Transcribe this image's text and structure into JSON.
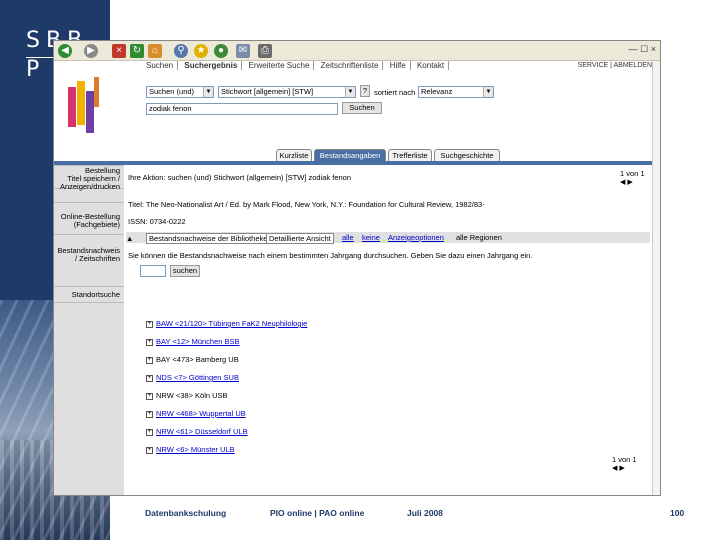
{
  "logo": {
    "line1": "SBB",
    "line2": "P"
  },
  "browser_toolbar": {
    "icons": [
      "back-icon",
      "forward-icon",
      "stop-icon",
      "refresh-icon",
      "home-icon",
      "search-icon",
      "favorites-icon",
      "media-icon",
      "mail-icon",
      "print-icon"
    ],
    "window_controls": "— ☐ ×"
  },
  "topnav": {
    "items": [
      "Suchen",
      "Suchergebnis",
      "Erweiterte Suche",
      "Zeitschriftenliste",
      "Hilfe",
      "Kontakt"
    ],
    "active_index": 1,
    "right_text": "SERVICE | ABMELDEN"
  },
  "search": {
    "field_select": "Suchen (und)",
    "index_select": "Stichwort [allgemein] [STW]",
    "sort_label": "sortiert nach",
    "sort_select": "Relevanz",
    "query_value": "zodiak fenon",
    "submit_label": "Suchen"
  },
  "tabs": [
    "Kurzliste",
    "Bestandsangaben",
    "Trefferliste",
    "Suchgeschichte"
  ],
  "active_tab": 1,
  "sidenav": [
    "Bestellung",
    "Titel speichern / Anzeigen/drucken",
    "Online-Bestellung (Fachgebiete)",
    "Bestandsnachweis / Zeitschriften",
    "Standortsuche"
  ],
  "main": {
    "current_action": "Ihre Aktion: suchen (und) Stichwort (allgemein) [STW] zodiak fenon",
    "hits_label": "1 von 1",
    "title_line": "Titel: The Neo-Nationalist Art / Ed. by Mark Flood, New York, N.Y.: Foundation for Cultural Review, 1982/83-",
    "issn_line": "ISSN: 0734-0222",
    "bar_tabs": [
      "Bestandsnachweise der Bibliotheken",
      "Detaillierte Ansicht",
      "alle",
      "keine",
      "Anzeigeoptionen",
      "alle Regionen"
    ],
    "note_line": "Sie können die Bestandsnachweise nach einem bestimmten Jahrgang durchsuchen. Geben Sie dazu einen Jahrgang ein.",
    "year_button": "suchen",
    "holdings": [
      {
        "label": "BAW <21/120> Tübingen FaK2 Neuphilologie",
        "link": true
      },
      {
        "label": "BAY <12> München BSB",
        "link": true
      },
      {
        "label": "BAY <473> Bamberg UB",
        "link": false
      },
      {
        "label": "NDS <7> Göttingen SUB",
        "link": true
      },
      {
        "label": "NRW <38> Köln USB",
        "link": false
      },
      {
        "label": "NRW <468> Wuppertal UB",
        "link": true
      },
      {
        "label": "NRW <61> Düsseldorf ULB",
        "link": true
      },
      {
        "label": "NRW <6> Münster ULB",
        "link": true
      }
    ],
    "bottom_hits": "1 von 1"
  },
  "footer": {
    "course": "Datenbankschulung",
    "title": "PIO online | PAO online",
    "date": "Juli 2008",
    "page": "100"
  },
  "colors": {
    "slide_blue": "#1e3a68",
    "tab_blue": "#4a6fa5",
    "link_blue": "#0000cc"
  }
}
